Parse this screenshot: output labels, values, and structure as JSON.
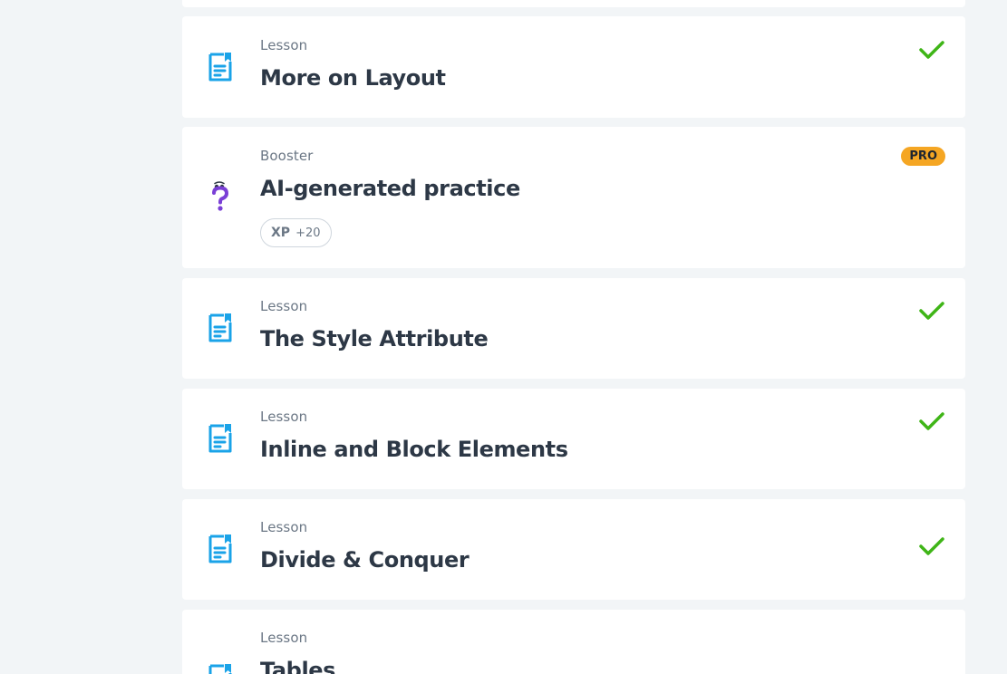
{
  "colors": {
    "background": "#f2f5f7",
    "card": "#ffffff",
    "lesson_icon": "#1aa3e8",
    "check": "#3fb517",
    "pro_badge": "#f5a623",
    "booster_icon": "#7a3fd6"
  },
  "items": [
    {
      "type": "Lesson",
      "title": "More on Layout",
      "icon": "document-bookmark-icon",
      "completed": true
    },
    {
      "type": "Booster",
      "title": "AI-generated practice",
      "icon": "question-mark-icon",
      "badge": "PRO",
      "xp_label": "XP",
      "xp_value": "+20"
    },
    {
      "type": "Lesson",
      "title": "The Style Attribute",
      "icon": "document-bookmark-icon",
      "completed": true
    },
    {
      "type": "Lesson",
      "title": "Inline and Block Elements",
      "icon": "document-bookmark-icon",
      "completed": true
    },
    {
      "type": "Lesson",
      "title": "Divide & Conquer",
      "icon": "document-bookmark-icon",
      "completed": true
    },
    {
      "type": "Lesson",
      "title": "Tables",
      "icon": "document-bookmark-icon",
      "completed": false
    }
  ]
}
